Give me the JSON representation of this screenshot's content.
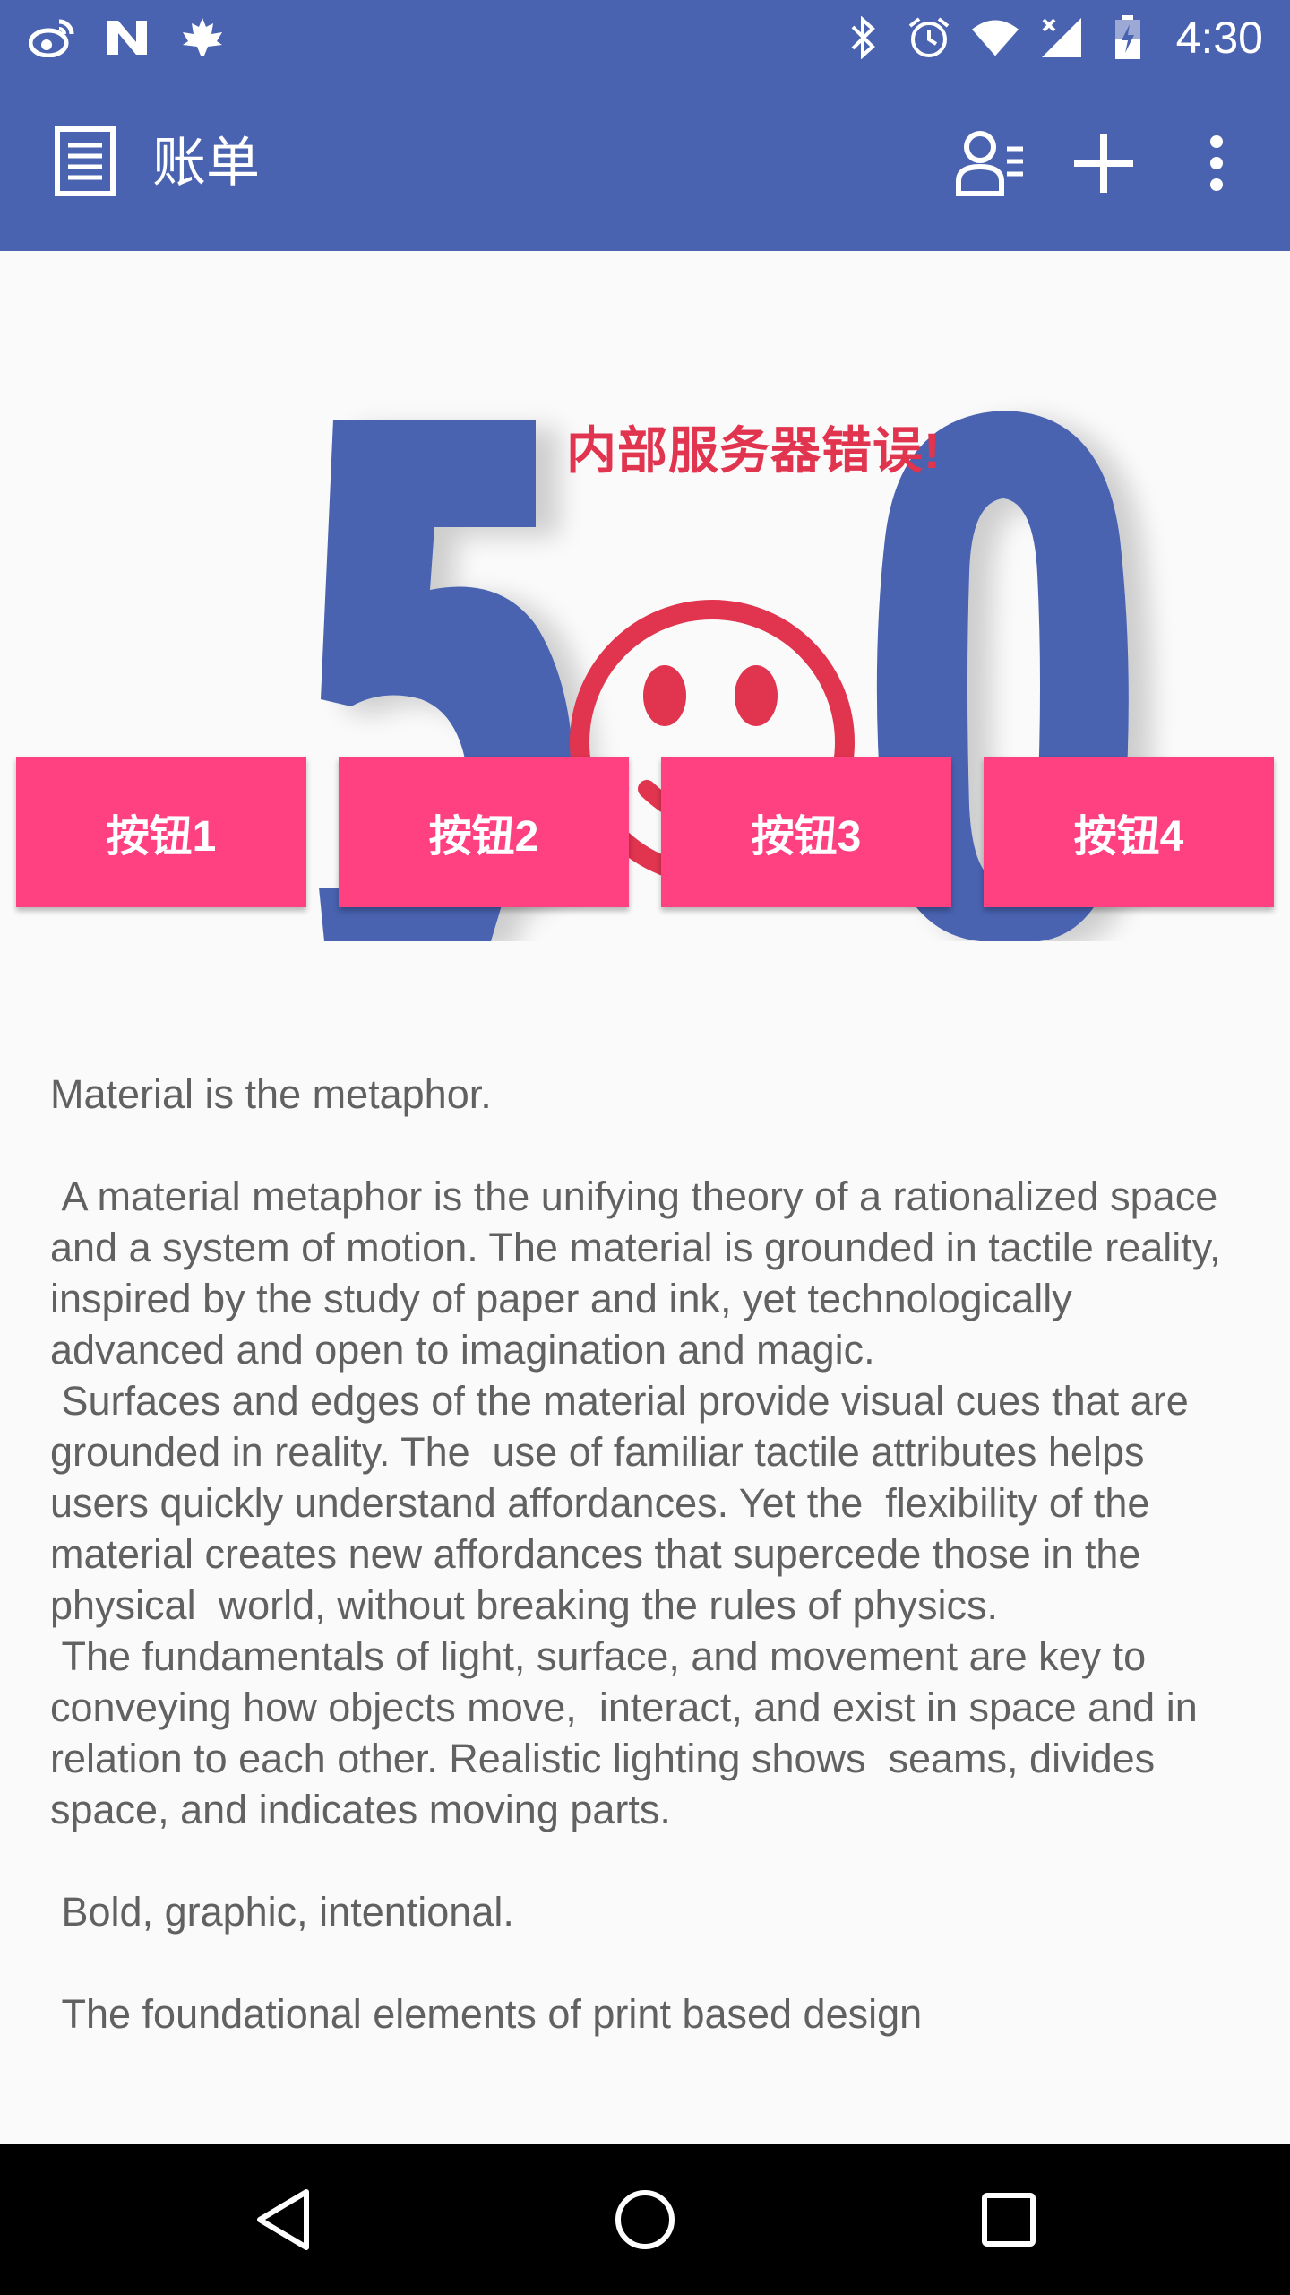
{
  "status_bar": {
    "time": "4:30",
    "left_icons": [
      "weibo-icon",
      "n-app-icon",
      "maple-leaf-icon"
    ],
    "right_icons": [
      "bluetooth-icon",
      "alarm-icon",
      "wifi-icon",
      "cellular-no-signal-icon",
      "battery-charging-icon"
    ]
  },
  "toolbar": {
    "title": "账单",
    "title_icon": "document-list-icon",
    "actions": [
      "contacts-list-icon",
      "add-icon",
      "more-vert-icon"
    ],
    "background": "#4a63b1"
  },
  "banner": {
    "image_text": "内部服务器错误!",
    "numbers": "500",
    "colors": {
      "digits": "#4a63b1",
      "face": "#e0344f"
    }
  },
  "buttons": [
    {
      "label": "按钮1"
    },
    {
      "label": "按钮2"
    },
    {
      "label": "按钮3"
    },
    {
      "label": "按钮4"
    }
  ],
  "button_color": "#ff4081",
  "content": {
    "text": "Material is the metaphor.\n\n A material metaphor is the unifying theory of a rationalized space and a system of motion. The material is grounded in tactile reality, inspired by the study of paper and ink, yet technologically advanced and open to imagination and magic.\n Surfaces and edges of the material provide visual cues that are grounded in reality. The  use of familiar tactile attributes helps users quickly understand affordances. Yet the  flexibility of the material creates new affordances that supercede those in the physical  world, without breaking the rules of physics.\n The fundamentals of light, surface, and movement are key to conveying how objects move,  interact, and exist in space and in relation to each other. Realistic lighting shows  seams, divides space, and indicates moving parts.\n\n Bold, graphic, intentional.\n\n The foundational elements of print based design"
  },
  "nav_bar": {
    "buttons": [
      "back-triangle-icon",
      "home-circle-icon",
      "recents-square-icon"
    ]
  }
}
